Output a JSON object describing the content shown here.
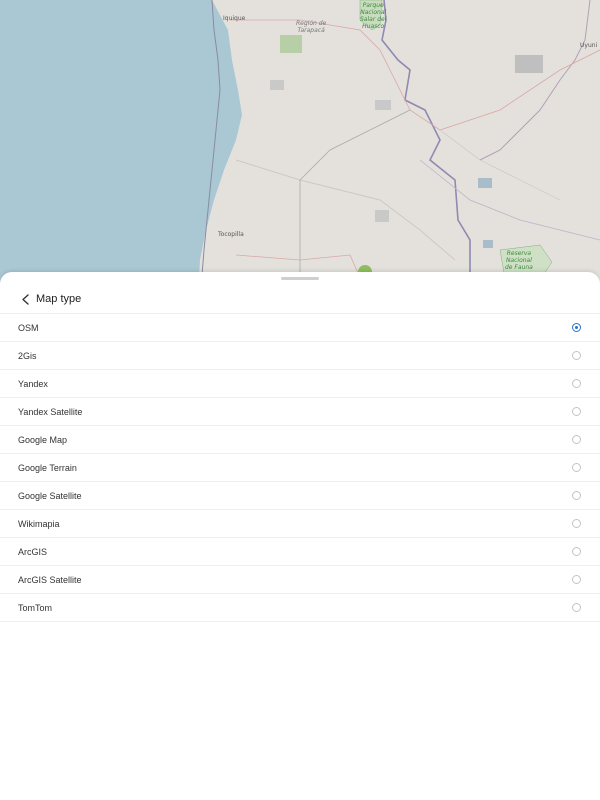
{
  "map": {
    "labels": {
      "iquique": "Iquique",
      "tocopilla": "Tocopilla",
      "uyuni": "Uyuni",
      "region": "Región de\nTarapacá",
      "park_top": "Parque\nNacional\nSalar del\nHuasco",
      "park_bottom": "Reserva\nNacional\nde Fauna"
    }
  },
  "sheet": {
    "title": "Map type",
    "selected": "OSM",
    "options": [
      {
        "label": "OSM",
        "checked": true
      },
      {
        "label": "2Gis",
        "checked": false
      },
      {
        "label": "Yandex",
        "checked": false
      },
      {
        "label": "Yandex Satellite",
        "checked": false
      },
      {
        "label": "Google Map",
        "checked": false
      },
      {
        "label": "Google Terrain",
        "checked": false
      },
      {
        "label": "Google Satellite",
        "checked": false
      },
      {
        "label": "Wikimapia",
        "checked": false
      },
      {
        "label": "ArcGIS",
        "checked": false
      },
      {
        "label": "ArcGIS Satellite",
        "checked": false
      },
      {
        "label": "TomTom",
        "checked": false
      }
    ]
  },
  "colors": {
    "accent": "#2a73c9",
    "sea": "#aac8d4",
    "land": "#e4e1dc"
  }
}
